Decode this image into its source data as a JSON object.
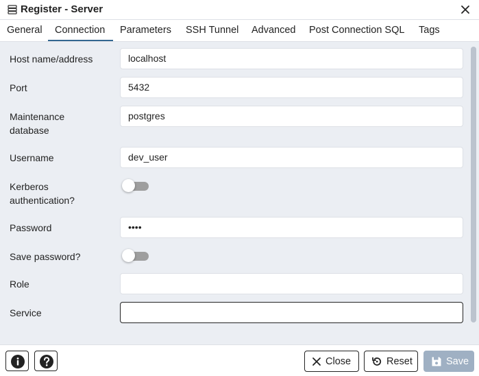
{
  "window": {
    "title": "Register - Server",
    "title_icon": "server-icon",
    "close_icon": "close-icon"
  },
  "tabs": [
    {
      "label": "General",
      "active": false
    },
    {
      "label": "Connection",
      "active": true
    },
    {
      "label": "Parameters",
      "active": false
    },
    {
      "label": "SSH Tunnel",
      "active": false
    },
    {
      "label": "Advanced",
      "active": false
    },
    {
      "label": "Post Connection SQL",
      "active": false
    },
    {
      "label": "Tags",
      "active": false
    }
  ],
  "form": {
    "host": {
      "label": "Host name/address",
      "value": "localhost"
    },
    "port": {
      "label": "Port",
      "value": "5432"
    },
    "maintenance_db": {
      "label_line1": "Maintenance",
      "label_line2": "database",
      "value": "postgres"
    },
    "username": {
      "label": "Username",
      "value": "dev_user"
    },
    "kerberos": {
      "label_line1": "Kerberos",
      "label_line2": "authentication?",
      "enabled": false
    },
    "password": {
      "label": "Password",
      "value": "••••"
    },
    "save_password": {
      "label": "Save password?",
      "enabled": false
    },
    "role": {
      "label": "Role",
      "value": ""
    },
    "service": {
      "label": "Service",
      "value": ""
    }
  },
  "footer": {
    "info_icon": "info-icon",
    "help_icon": "help-icon",
    "close_label": "Close",
    "reset_label": "Reset",
    "save_label": "Save"
  },
  "colors": {
    "tab_underline": "#326690",
    "content_background": "#ebeef3",
    "save_button_disabled": "#9fb0c3"
  }
}
